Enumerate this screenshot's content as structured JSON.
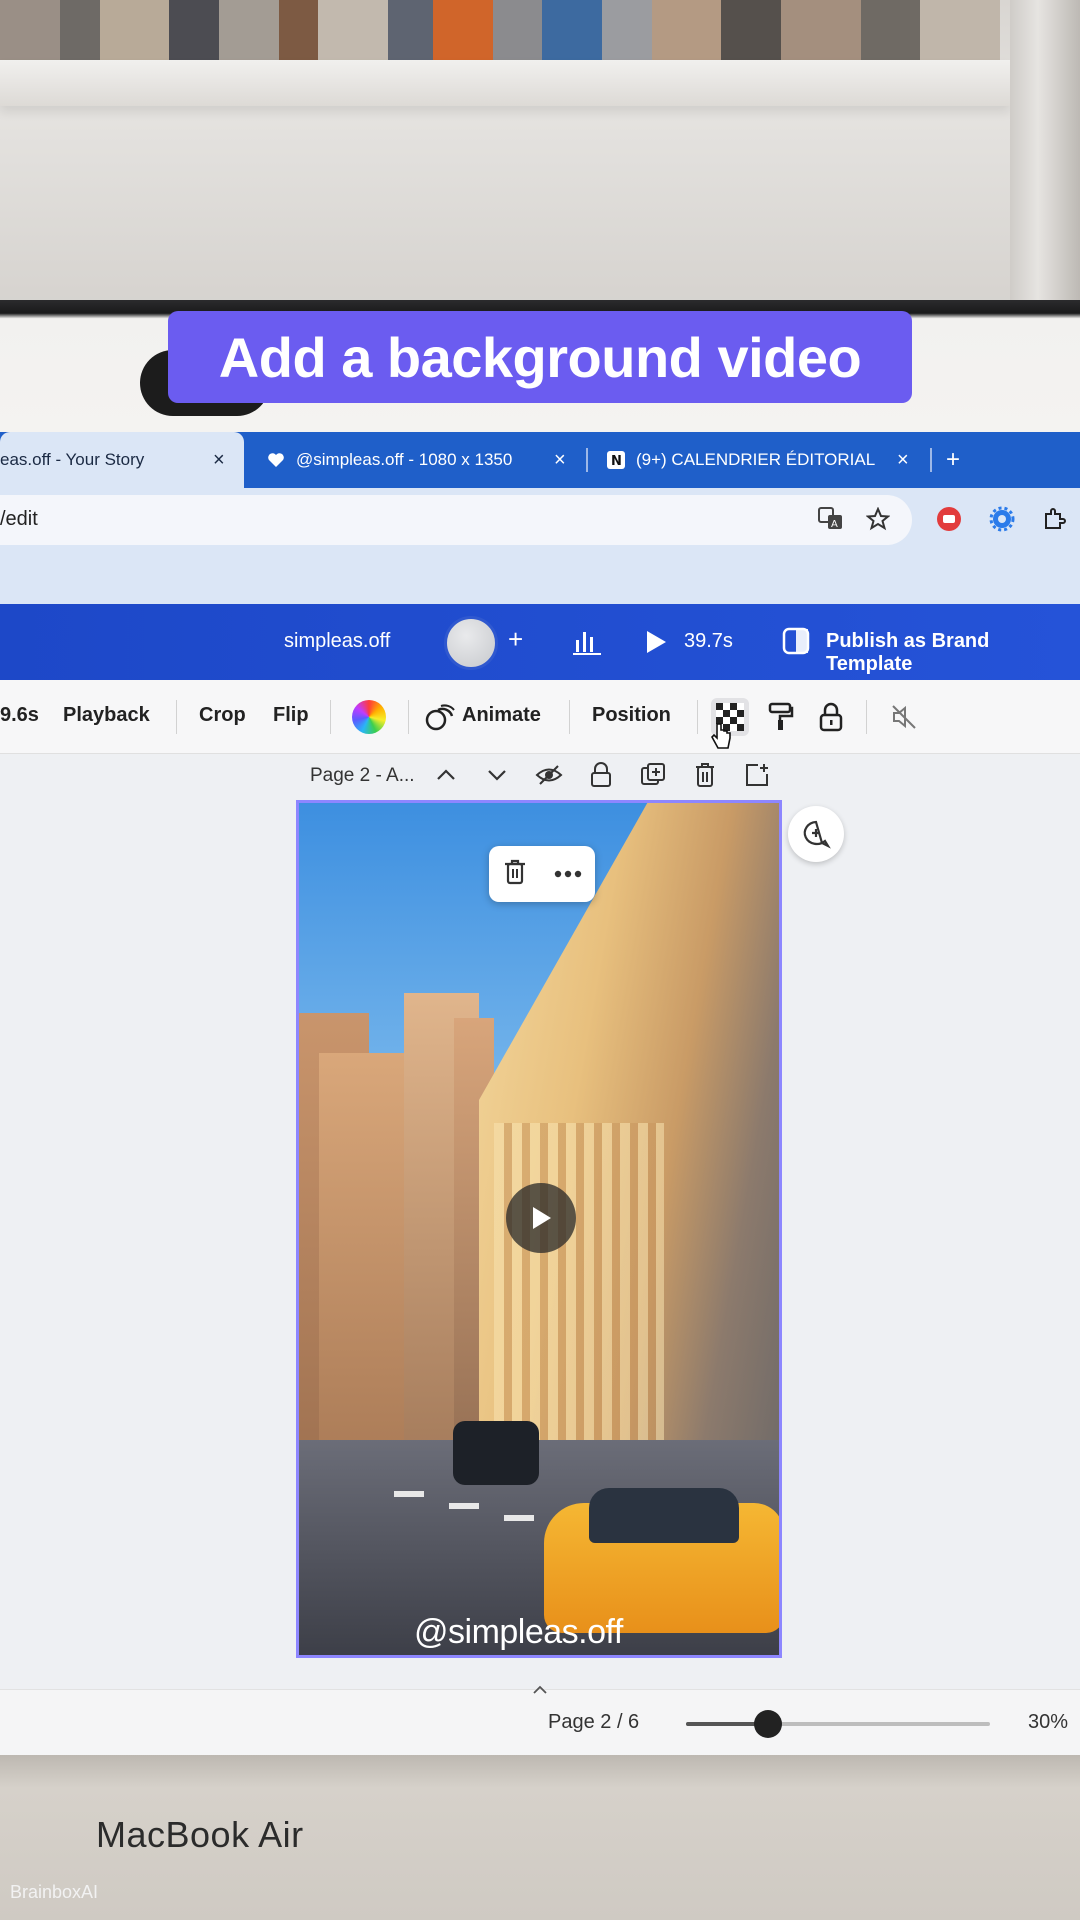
{
  "caption": "Add a background video",
  "laptop_label": "MacBook Air",
  "watermark": "BrainboxAI",
  "browser": {
    "tabs": [
      {
        "title": "eas.off - Your Story",
        "active": true
      },
      {
        "title": "@simpleas.off - 1080 x 1350",
        "active": false
      },
      {
        "title": "(9+) CALENDRIER ÉDITORIAL",
        "active": false
      }
    ],
    "new_tab": "+",
    "close": "×",
    "url": "/edit"
  },
  "header": {
    "account": "simpleas.off",
    "add": "+",
    "duration": "39.7s",
    "publish": "Publish as Brand Template"
  },
  "toolbar": {
    "duration": "9.6s",
    "playback": "Playback",
    "crop": "Crop",
    "flip": "Flip",
    "animate": "Animate",
    "position": "Position"
  },
  "page_meta": {
    "title": "Page 2 - A..."
  },
  "canvas": {
    "handle": "@simpleas.off"
  },
  "footer": {
    "page_indicator": "Page 2 / 6",
    "zoom": "30%",
    "zoom_level": 0.27
  },
  "colors": {
    "caption_bg": "#6b5cf0",
    "tabbar": "#1f5fc9",
    "canva_header": "#1d48c8",
    "selection": "#8d86ff"
  }
}
